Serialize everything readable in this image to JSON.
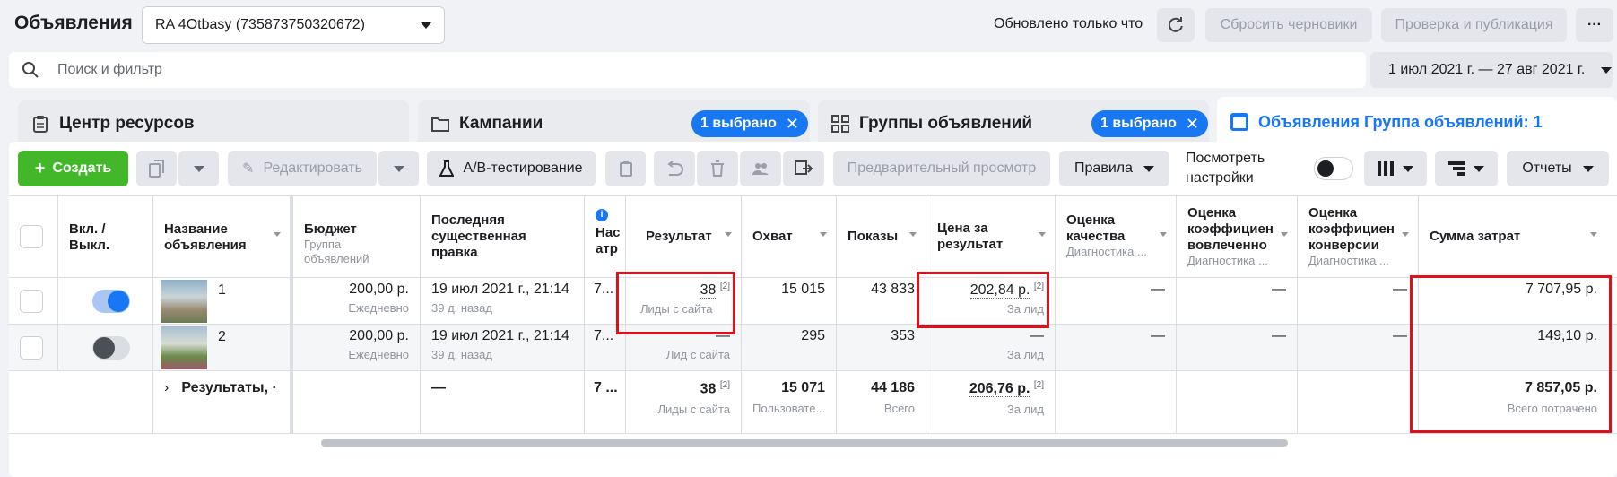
{
  "header": {
    "title": "Объявления",
    "account": "RA 4Otbasy (735873750320672)",
    "updated": "Обновлено только что",
    "reset_drafts": "Сбросить черновики",
    "publish": "Проверка и публикация",
    "more": "···"
  },
  "search": {
    "placeholder": "Поиск и фильтр"
  },
  "date_range": "1 июл 2021 г. — 27 авг 2021 г.",
  "tabs": {
    "resources": "Центр ресурсов",
    "campaigns": "Кампании",
    "campaigns_selected": "1 выбрано",
    "adsets": "Группы объявлений",
    "adsets_selected": "1 выбрано",
    "ads": "Объявления Группа объявлений: 1"
  },
  "toolbar": {
    "create": "Создать",
    "edit": "Редактировать",
    "ab_test": "А/В-тестирование",
    "preview": "Предварительный просмотр",
    "rules": "Правила",
    "view_settings_line1": "Посмотреть",
    "view_settings_line2": "настройки",
    "reports": "Отчеты"
  },
  "columns": {
    "onoff_1": "Вкл. /",
    "onoff_2": "Выкл.",
    "name_1": "Название",
    "name_2": "объявления",
    "budget": "Бюджет",
    "budget_sub": "Группа объявлений",
    "lastedit_1": "Последняя",
    "lastedit_2": "существенная",
    "lastedit_3": "правка",
    "attr_1": "Нас",
    "attr_2": "атр",
    "result": "Результат",
    "reach": "Охват",
    "impressions": "Показы",
    "cpr_1": "Цена за",
    "cpr_2": "результат",
    "quality_1": "Оценка",
    "quality_2": "качества",
    "quality_sub": "Диагностика ...",
    "engagement_1": "Оценка",
    "engagement_2": "коэффициен",
    "engagement_3": "вовлеченно",
    "engagement_sub": "Диагностика ...",
    "conversion_1": "Оценка",
    "conversion_2": "коэффициен",
    "conversion_3": "конверсии",
    "conversion_sub": "Диагностика ...",
    "spend": "Сумма затрат"
  },
  "rows": [
    {
      "name": "1",
      "on": true,
      "budget": "200,00 р.",
      "budget_sub": "Ежедневно",
      "lastedit": "19 июл 2021 г., 21:14",
      "lastedit_sub": "39 д. назад",
      "attr": "7...",
      "result": "38",
      "result_sup": "[2]",
      "result_sub": "Лиды с сайта",
      "reach": "15 015",
      "impressions": "43 833",
      "cpr": "202,84 р.",
      "cpr_sup": "[2]",
      "cpr_sub": "За лид",
      "quality": "—",
      "engagement": "—",
      "conversion": "—",
      "spend": "7 707,95 р."
    },
    {
      "name": "2",
      "on": false,
      "budget": "200,00 р.",
      "budget_sub": "Ежедневно",
      "lastedit": "19 июл 2021 г., 21:14",
      "lastedit_sub": "39 д. назад",
      "attr": "7...",
      "result": "—",
      "result_sub": "Лид с сайта",
      "reach": "295",
      "impressions": "353",
      "cpr": "—",
      "cpr_sub": "За лид",
      "quality": "—",
      "engagement": "—",
      "conversion": "—",
      "spend": "149,10 р."
    }
  ],
  "totals": {
    "label": "Результаты, ·",
    "lastedit": "—",
    "attr": "7 ...",
    "result": "38",
    "result_sup": "[2]",
    "result_sub": "Лиды с сайта",
    "reach": "15 071",
    "reach_sub": "Пользовате...",
    "impressions": "44 186",
    "impressions_sub": "Всего",
    "cpr": "206,76 р.",
    "cpr_sup": "[2]",
    "cpr_sub": "За лид",
    "spend": "7 857,05 р.",
    "spend_sub": "Всего потрачено"
  },
  "colors": {
    "accent": "#1877f2",
    "create": "#42b72a",
    "highlight": "#e0101a"
  }
}
